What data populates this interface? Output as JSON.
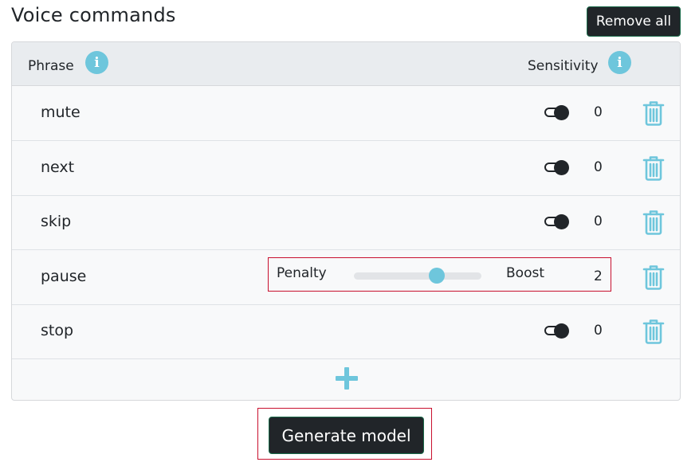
{
  "page": {
    "title": "Voice commands",
    "remove_all_label": "Remove all"
  },
  "table": {
    "headers": {
      "phrase": "Phrase",
      "sensitivity": "Sensitivity"
    },
    "rows": [
      {
        "phrase": "mute",
        "value": "0",
        "mode": "toggle"
      },
      {
        "phrase": "next",
        "value": "0",
        "mode": "toggle"
      },
      {
        "phrase": "skip",
        "value": "0",
        "mode": "toggle"
      },
      {
        "phrase": "pause",
        "value": "2",
        "mode": "slider",
        "slider": {
          "min_label": "Penalty",
          "max_label": "Boost",
          "position_fraction": 0.65
        }
      },
      {
        "phrase": "stop",
        "value": "0",
        "mode": "toggle"
      }
    ]
  },
  "footer": {
    "generate_label": "Generate model"
  },
  "icons": {
    "info": "info-icon",
    "delete": "trash-icon",
    "add": "plus-icon",
    "toggle": "toggle-icon"
  },
  "colors": {
    "accent": "#6ec6dc",
    "dark": "#212529",
    "highlight": "#c8102e"
  }
}
